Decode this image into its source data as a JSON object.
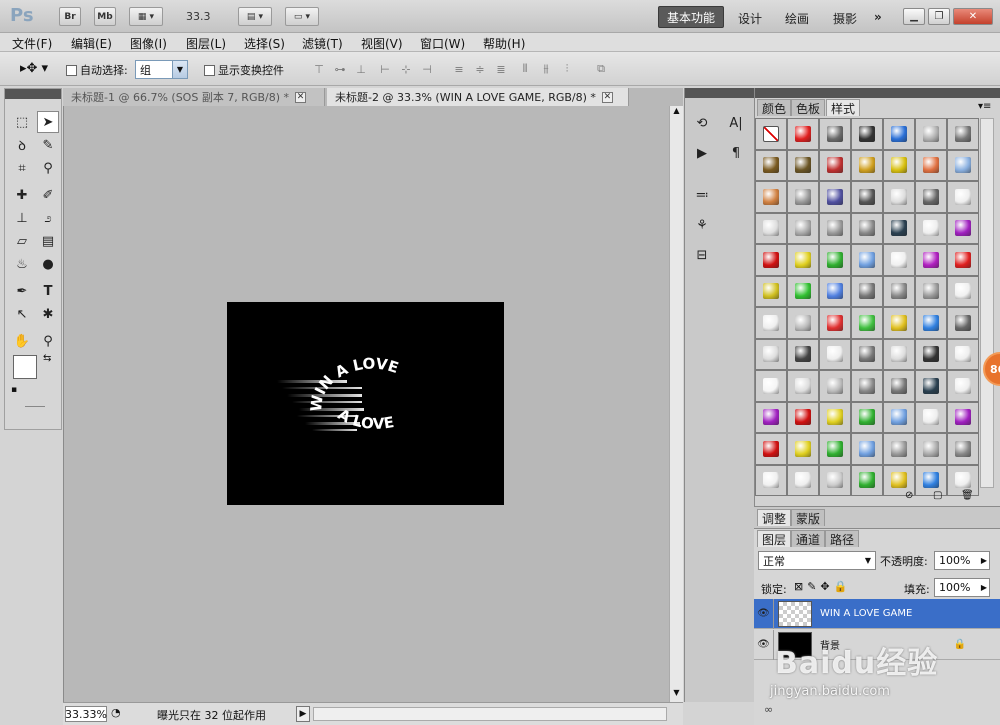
{
  "titlebar": {
    "logo": "Ps",
    "btn_br": "Br",
    "btn_mb": "Mb",
    "zoom_label": "33.3",
    "workspaces": {
      "active": "基本功能",
      "design": "设计",
      "painting": "绘画",
      "photography": "摄影",
      "more": "»"
    }
  },
  "menubar": {
    "items": [
      "文件(F)",
      "编辑(E)",
      "图像(I)",
      "图层(L)",
      "选择(S)",
      "滤镜(T)",
      "视图(V)",
      "窗口(W)",
      "帮助(H)"
    ]
  },
  "options": {
    "auto_select_label": "自动选择:",
    "auto_select_value": "组",
    "show_transform_label": "显示变换控件"
  },
  "documents": {
    "tabs": [
      {
        "label": "未标题-1 @ 66.7% (SOS 副本 7, RGB/8) *"
      },
      {
        "label": "未标题-2 @ 33.3% (WIN A LOVE GAME, RGB/8) *"
      }
    ],
    "canvas_text_top": "WIN A LOVE",
    "canvas_text_bottom": "A LOVE"
  },
  "statusbar": {
    "zoom": "33.33%",
    "message": "曝光只在 32 位起作用"
  },
  "styles_panel": {
    "tabs": [
      "颜色",
      "色板",
      "样式"
    ],
    "active_tab": "样式"
  },
  "adjust_panel": {
    "tabs": [
      "调整",
      "蒙版"
    ]
  },
  "layers_panel": {
    "tabs": [
      "图层",
      "通道",
      "路径"
    ],
    "blend_mode": "正常",
    "opacity_label": "不透明度:",
    "opacity_value": "100%",
    "lock_label": "锁定:",
    "fill_label": "填充:",
    "fill_value": "100%",
    "layers": [
      {
        "name": "WIN A LOVE GAME",
        "selected": true
      },
      {
        "name": "背景",
        "selected": false
      }
    ]
  },
  "overlay": {
    "badge": "86",
    "watermark": "Baidu经验",
    "watermark_url": "jingyan.baidu.com"
  },
  "colors": {
    "selection_blue": "#3a6ec8",
    "accent_orange": "#e8732c"
  }
}
